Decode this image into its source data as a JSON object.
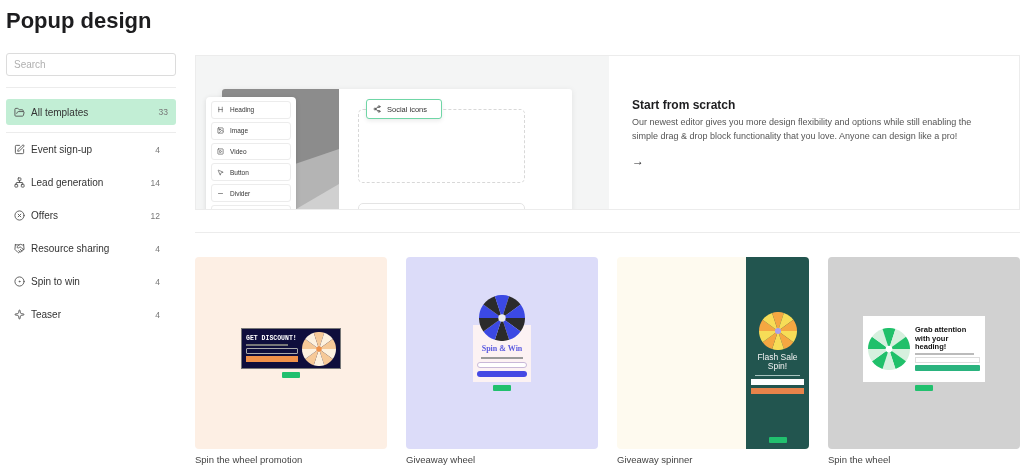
{
  "page_title": "Popup design",
  "sidebar": {
    "search": {
      "placeholder": "Search"
    },
    "all": {
      "label": "All templates",
      "count": "33",
      "selected": true
    },
    "categories": [
      {
        "label": "Event sign-up",
        "count": "4",
        "selected": false
      },
      {
        "label": "Lead generation",
        "count": "14",
        "selected": false
      },
      {
        "label": "Offers",
        "count": "12",
        "selected": false
      },
      {
        "label": "Resource sharing",
        "count": "4",
        "selected": false
      },
      {
        "label": "Spin to win",
        "count": "4",
        "selected": false
      },
      {
        "label": "Teaser",
        "count": "4",
        "selected": false
      }
    ]
  },
  "hero": {
    "blocks": [
      "Heading",
      "Image",
      "Video",
      "Button",
      "Divider"
    ],
    "chip": "Social icons",
    "title": "Start from scratch",
    "description": "Our newest editor gives you more design flexibility and options while still enabling the simple drag & drop block functionality that you love. Anyone can design like a pro!",
    "arrow": "→"
  },
  "templates": [
    {
      "title": "Spin the wheel promotion",
      "color": "#fdefe4",
      "popup": {
        "kind": "dark",
        "heading": "GET DISCOUNT!"
      }
    },
    {
      "title": "Giveaway wheel",
      "color": "#dcdcf9",
      "popup": {
        "kind": "top-wheel",
        "heading": "Spin & Win"
      }
    },
    {
      "title": "Giveaway spinner",
      "color": "#fefaef",
      "popup": {
        "kind": "side-panel",
        "heading": "Flash Sale Spin!"
      }
    },
    {
      "title": "Spin the wheel",
      "color": "#d1d1d1",
      "popup": {
        "kind": "white",
        "heading": "Grab attention with your heading!"
      }
    }
  ]
}
